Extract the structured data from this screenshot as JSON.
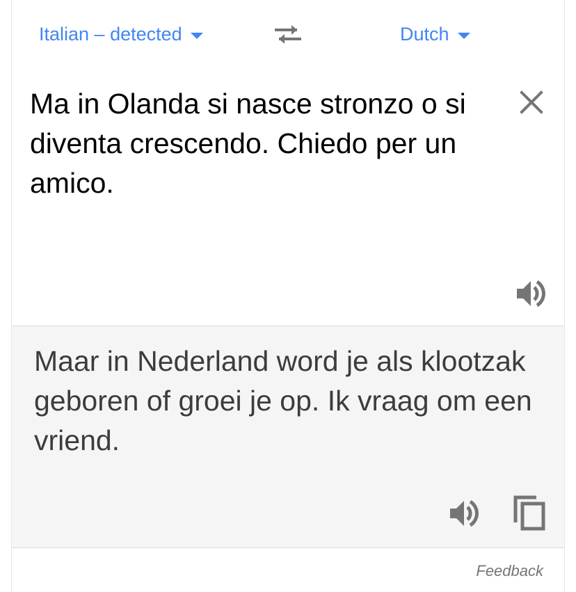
{
  "language_bar": {
    "source_language": "Italian – detected",
    "target_language": "Dutch",
    "swap_icon": "swap-arrows-icon",
    "caret_icon": "caret-down-icon",
    "accent_color": "#4285f4"
  },
  "source": {
    "text": "Ma in Olanda si nasce stronzo o si diventa crescendo. Chiedo per un amico.",
    "clear_icon": "close-icon",
    "listen_icon": "speaker-icon"
  },
  "translation": {
    "text": "Maar in Nederland word je als klootzak geboren of groei je op. Ik vraag om een vriend.",
    "listen_icon": "speaker-icon",
    "copy_icon": "copy-icon",
    "background": "#f5f5f5"
  },
  "footer": {
    "feedback_label": "Feedback"
  }
}
